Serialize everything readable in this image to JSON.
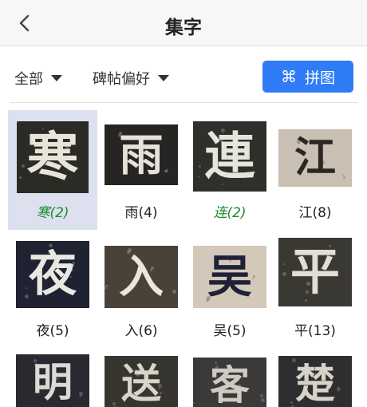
{
  "header": {
    "title": "集字",
    "back_icon": "chevron-left-icon"
  },
  "filters": {
    "all_label": "全部",
    "style_label": "碑帖偏好"
  },
  "puzzle_button": {
    "icon": "⌘",
    "label": "拼图"
  },
  "colors": {
    "accent": "#2f7cf6",
    "selected_bg": "#dde1ef",
    "green_caption": "#1e8a2e"
  },
  "items": [
    {
      "char": "寒",
      "caption": "寒(2)",
      "selected": true,
      "caption_style": "green",
      "bg": "#2b2b26",
      "ink": "#e8e4d8"
    },
    {
      "char": "雨",
      "caption": "雨(4)",
      "selected": false,
      "caption_style": "normal",
      "bg": "#262524",
      "ink": "#e6e2da"
    },
    {
      "char": "連",
      "caption": "连(2)",
      "selected": false,
      "caption_style": "green",
      "bg": "#2e302c",
      "ink": "#e4e6dc"
    },
    {
      "char": "江",
      "caption": "江(8)",
      "selected": false,
      "caption_style": "normal",
      "bg": "#c9bfb2",
      "ink": "#2a2622"
    },
    {
      "char": "夜",
      "caption": "夜(5)",
      "selected": false,
      "caption_style": "normal",
      "bg": "#1f2230",
      "ink": "#e9e7e2"
    },
    {
      "char": "入",
      "caption": "入(6)",
      "selected": false,
      "caption_style": "normal",
      "bg": "#4a4238",
      "ink": "#ece6da"
    },
    {
      "char": "吴",
      "caption": "吴(5)",
      "selected": false,
      "caption_style": "normal",
      "bg": "#d4c8bb",
      "ink": "#1f2236"
    },
    {
      "char": "平",
      "caption": "平(13)",
      "selected": false,
      "caption_style": "normal",
      "bg": "#3a3833",
      "ink": "#e2ded4"
    },
    {
      "char": "明",
      "caption": "",
      "selected": false,
      "caption_style": "normal",
      "bg": "#282a30",
      "ink": "#dcdad4"
    },
    {
      "char": "送",
      "caption": "",
      "selected": false,
      "caption_style": "normal",
      "bg": "#37352f",
      "ink": "#d8d4c8"
    },
    {
      "char": "客",
      "caption": "",
      "selected": false,
      "caption_style": "normal",
      "bg": "#3c3a38",
      "ink": "#cfcac2"
    },
    {
      "char": "楚",
      "caption": "",
      "selected": false,
      "caption_style": "normal",
      "bg": "#2e2e30",
      "ink": "#d6d2c8"
    }
  ]
}
